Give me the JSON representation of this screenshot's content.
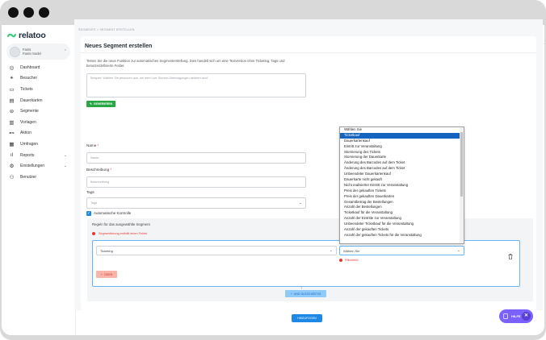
{
  "brand": {
    "name": "relatoo",
    "accent": "#2ecc71"
  },
  "user": {
    "line1": "Fanis",
    "line2": "Fanis model"
  },
  "nav": [
    {
      "label": "Dashboard",
      "icon": "dashboard-icon",
      "chevron": false
    },
    {
      "label": "Besucher",
      "icon": "visitors-icon",
      "chevron": false
    },
    {
      "label": "Tickets",
      "icon": "ticket-icon",
      "chevron": false
    },
    {
      "label": "Dauerkarten",
      "icon": "season-card-icon",
      "chevron": false
    },
    {
      "label": "Segmente",
      "icon": "segments-icon",
      "chevron": false
    },
    {
      "label": "Vorlagen",
      "icon": "templates-icon",
      "chevron": false
    },
    {
      "label": "Aktion",
      "icon": "action-icon",
      "chevron": false
    },
    {
      "label": "Umfragen",
      "icon": "survey-icon",
      "chevron": false
    },
    {
      "label": "Reports",
      "icon": "reports-icon",
      "chevron": true
    },
    {
      "label": "Einstellungen",
      "icon": "settings-icon",
      "chevron": true
    },
    {
      "label": "Benutzer",
      "icon": "users-icon",
      "chevron": false
    }
  ],
  "breadcrumb": "SEGMENTE > SEGMENT ERSTELLEN",
  "page": {
    "title": "Neues Segment erstellen",
    "intro": "Testen Sie die neue Funktion zur automatischen Segmenterstellung. Dies handelt sich um eine Textversion ohne Ticketing, Tags und benutzerdefinierte Felder.",
    "textarea_placeholder": "Beispiel: Wählen Sie personen aus, bei dem Live-Stream-Übertragungen aktiviert sind.",
    "generate_label": "GENERIEREN",
    "name_label": "Name",
    "name_placeholder": "Name",
    "description_label": "Beschreibung",
    "description_placeholder": "Beschreibung",
    "tags_label": "Tags",
    "tags_placeholder": "Tags",
    "auto_control_label": "Automatische Kontrolle",
    "rules_title": "Regeln für das ausgewählte Segment",
    "rules_error": "Segmentierung enthält einen Fehler",
    "rule_type_value": "Ticketing",
    "rule_choice_value": "Wählen Sie",
    "rule_choice_error": "Pflichtfeld",
    "or_label": "ODER",
    "and_label": "UND GLEICHZEITIG",
    "submit_label": "HINZUFÜGEN"
  },
  "dropdown_options": [
    "Wählen Sie",
    "Ticketkauf",
    "Dauerkartenkauf",
    "Eintritt zur Veranstaltung",
    "Stornierung des Tickets",
    "Stornierung der Dauerkarte",
    "Änderung des Barcodes auf dem Ticket",
    "Änderung des Barcodes auf dem Ticket",
    "Unbeendeter Dauerkartenkauf",
    "Dauerkarte nicht gekauft",
    "Nicht realisierter Eintritt zur Veranstaltung",
    "Preis der gekauften Tickets",
    "Preis der gekauften Dauerkarten",
    "Gesamtbetrag der Bestellungen",
    "Anzahl der Bestellungen",
    "Ticketkauf für die Veranstaltung",
    "Anzahl der Eintritte zur Veranstaltung",
    "Unbeendeter Ticketkauf für die Veranstaltung",
    "Anzahl der gekauften Tickets",
    "Anzahl der gekauften Tickets für die Veranstaltung"
  ],
  "dropdown_highlighted_index": 1,
  "help": {
    "label": "HILFE"
  }
}
